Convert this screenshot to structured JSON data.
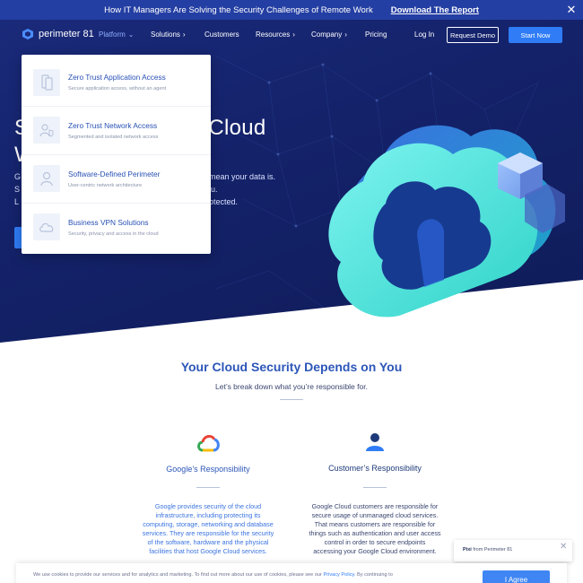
{
  "announcement": {
    "text": "How IT Managers Are Solving the Security Challenges of Remote Work",
    "link": "Download The Report",
    "close": "✕"
  },
  "nav": {
    "logo": "perimeter 81",
    "items": [
      {
        "label": "Platform",
        "chevron": "⌄"
      },
      {
        "label": "Solutions",
        "chevron": "›"
      },
      {
        "label": "Customers"
      },
      {
        "label": "Resources",
        "chevron": "›"
      },
      {
        "label": "Company",
        "chevron": "›"
      },
      {
        "label": "Pricing"
      }
    ],
    "login": "Log In",
    "request_demo": "Request Demo",
    "start_now": "Start Now"
  },
  "hero": {
    "title_line1_start": "S",
    "title_line1_end": "Cloud",
    "title_line2_start": "W",
    "body_line1_start": "G",
    "body_line1_end": "’t mean your data is.",
    "body_line2_start": "S",
    "body_line2_end": "u.",
    "body_line3_start": "L",
    "body_line3_end": "otected."
  },
  "dropdown": {
    "items": [
      {
        "title": "Zero Trust Application Access",
        "subtitle": "Secure application access, without an agent",
        "icon": "mobile-icon"
      },
      {
        "title": "Zero Trust Network Access",
        "subtitle": "Segmented and isolated network access",
        "icon": "user-shield-icon"
      },
      {
        "title": "Software-Defined Perimeter",
        "subtitle": "User-centric network architecture",
        "icon": "user-icon"
      },
      {
        "title": "Business VPN Solutions",
        "subtitle": "Security, privacy and access in the cloud",
        "icon": "cloud-icon"
      }
    ]
  },
  "section": {
    "title": "Your Cloud Security Depends on You",
    "subtitle": "Let’s break down what you’re responsible for.",
    "columns": [
      {
        "title": "Google’s Responsibility",
        "icon": "google-cloud-icon",
        "lines": [
          "Google provides security of the cloud",
          "infrastructure, including protecting its",
          "computing, storage, networking and database",
          "services. They are responsible for the security",
          "of the software, hardware and the physical",
          "facilities that host Google Cloud services."
        ]
      },
      {
        "title": "Customer’s Responsibility",
        "icon": "customer-icon",
        "lines": [
          "Google Cloud customers are responsible for",
          "secure usage of unmanaged cloud services.",
          "That means customers are responsible for",
          "things such as authentication and user access",
          "control in order to secure endpoints",
          "accessing your Google Cloud environment."
        ]
      }
    ]
  },
  "chat": {
    "sender": "Pixi",
    "from": " from Perimeter 81",
    "close": "✕"
  },
  "cookie": {
    "text_before": "We use cookies to provide our services and for analytics and marketing. To find out more about our use of cookies, please see our ",
    "privacy_link": "Privacy Policy",
    "text_after": ". By continuing to",
    "agree": "I Agree"
  },
  "colors": {
    "brand_blue": "#2f7cf6",
    "hero_navy": "#14226a",
    "heading_blue": "#2c56b8"
  }
}
